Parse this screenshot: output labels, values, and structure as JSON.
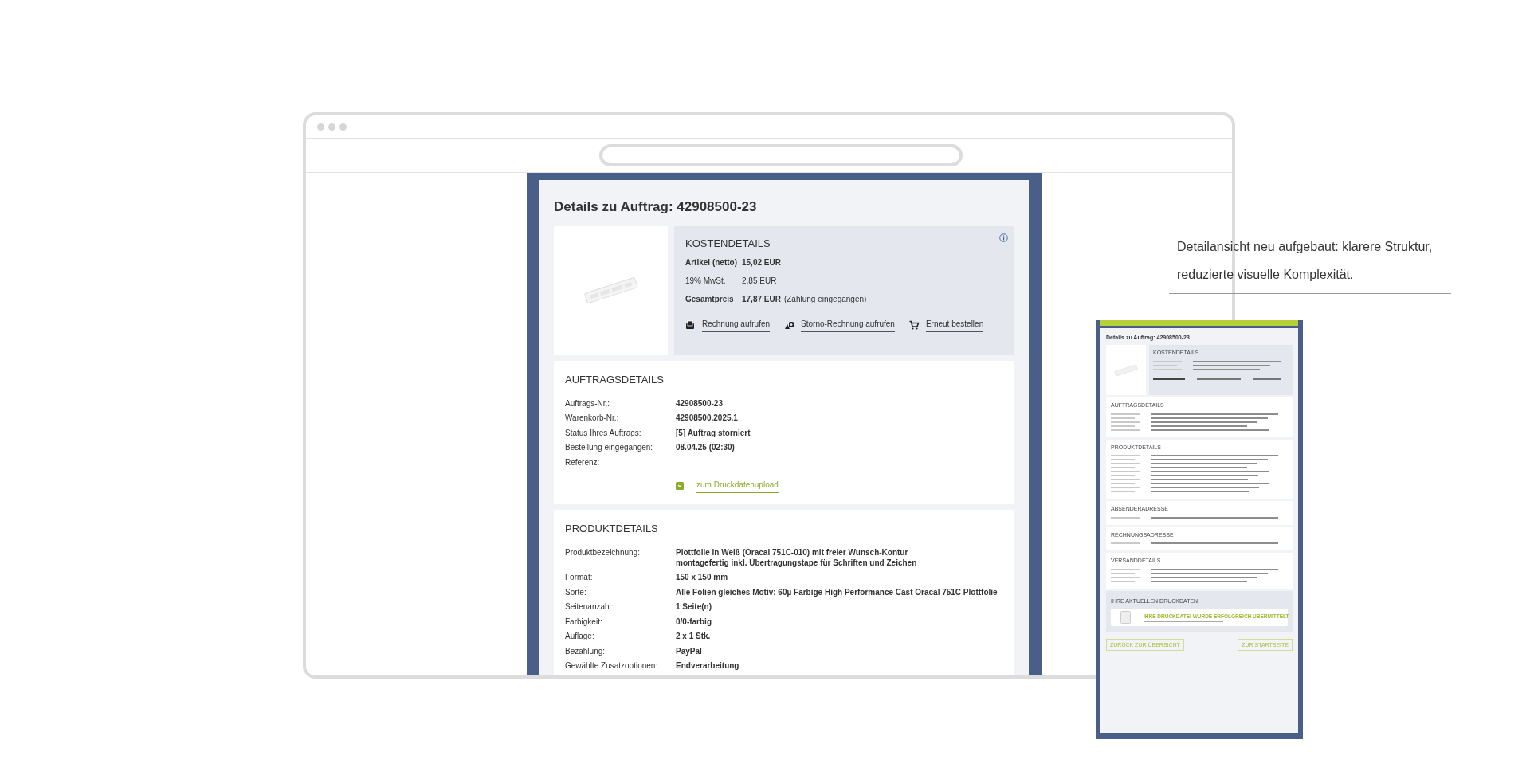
{
  "order_page": {
    "title": "Details zu Auftrag: 42908500-23",
    "cost_details": {
      "heading": "KOSTENDETAILS",
      "rows": [
        {
          "label": "Artikel (netto)",
          "value": "15,02 EUR",
          "emphasis": true
        },
        {
          "label": "19% MwSt.",
          "value": "2,85 EUR",
          "emphasis": false
        },
        {
          "label": "Gesamtpreis",
          "value": "17,87 EUR",
          "note": "(Zahlung eingegangen)",
          "emphasis": true
        }
      ],
      "actions": [
        {
          "label": "Rechnung aufrufen",
          "kind": "invoice"
        },
        {
          "label": "Storno-Rechnung aufrufen",
          "kind": "storno"
        },
        {
          "label": "Erneut bestellen",
          "kind": "cart"
        }
      ]
    },
    "order_details": {
      "heading": "AUFTRAGSDETAILS",
      "rows": [
        {
          "label": "Auftrags-Nr.:",
          "value": "42908500-23"
        },
        {
          "label": "Warenkorb-Nr.:",
          "value": "42908500.2025.1"
        },
        {
          "label": "Status Ihres Auftrags:",
          "value": "[5] Auftrag storniert"
        },
        {
          "label": "Bestellung eingegangen:",
          "value": "08.04.25 (02:30)"
        },
        {
          "label": "Referenz:"
        }
      ],
      "upload_link": "zum Druckdatenupload"
    },
    "product_details": {
      "heading": "PRODUKTDETAILS",
      "rows": [
        {
          "label": "Produktbezeichnung:",
          "value": "Plottfolie in Weiß (Oracal 751C-010) mit freier Wunsch-Kontur\nmontagefertig inkl. Übertragungstape für Schriften und Zeichen"
        },
        {
          "label": "Format:",
          "value": "150 x 150 mm"
        },
        {
          "label": "Sorte:",
          "value": "Alle Folien gleiches Motiv: 60µ Farbige High Performance Cast Oracal 751C Plottfolie"
        },
        {
          "label": "Seitenanzahl:",
          "value": "1 Seite(n)"
        },
        {
          "label": "Farbigkeit:",
          "value": "0/0-farbig"
        },
        {
          "label": "Auflage:",
          "value": "2 x 1 Stk."
        },
        {
          "label": "Bezahlung:",
          "value": "PayPal"
        },
        {
          "label": "Gewählte Zusatzoptionen:",
          "value": "Endverarbeitung"
        }
      ]
    }
  },
  "caption": "Detailansicht neu aufgebaut: klarere Struktur, reduzierte visuelle Komplexität.",
  "mobile_preview": {
    "title": "Details zu Auftrag: 42908500-23",
    "cost_heading": "KOSTENDETAILS",
    "sections": [
      {
        "heading": "AUFTRAGSDETAILS"
      },
      {
        "heading": "PRODUKTDETAILS"
      },
      {
        "heading": "ABSENDERADRESSE"
      },
      {
        "heading": "RECHNUNGSADRESSE"
      },
      {
        "heading": "VERSANDDETAILS"
      }
    ],
    "print_data": {
      "heading": "IHRE AKTUELLEN DRUCKDATEN",
      "notice": "IHRE DRUCKDATEI WURDE ERFOLGREICH ÜBERMITTELT"
    },
    "buttons": [
      {
        "label": "ZURÜCK ZUR ÜBERSICHT"
      },
      {
        "label": "ZUR STARTSEITE"
      }
    ]
  }
}
